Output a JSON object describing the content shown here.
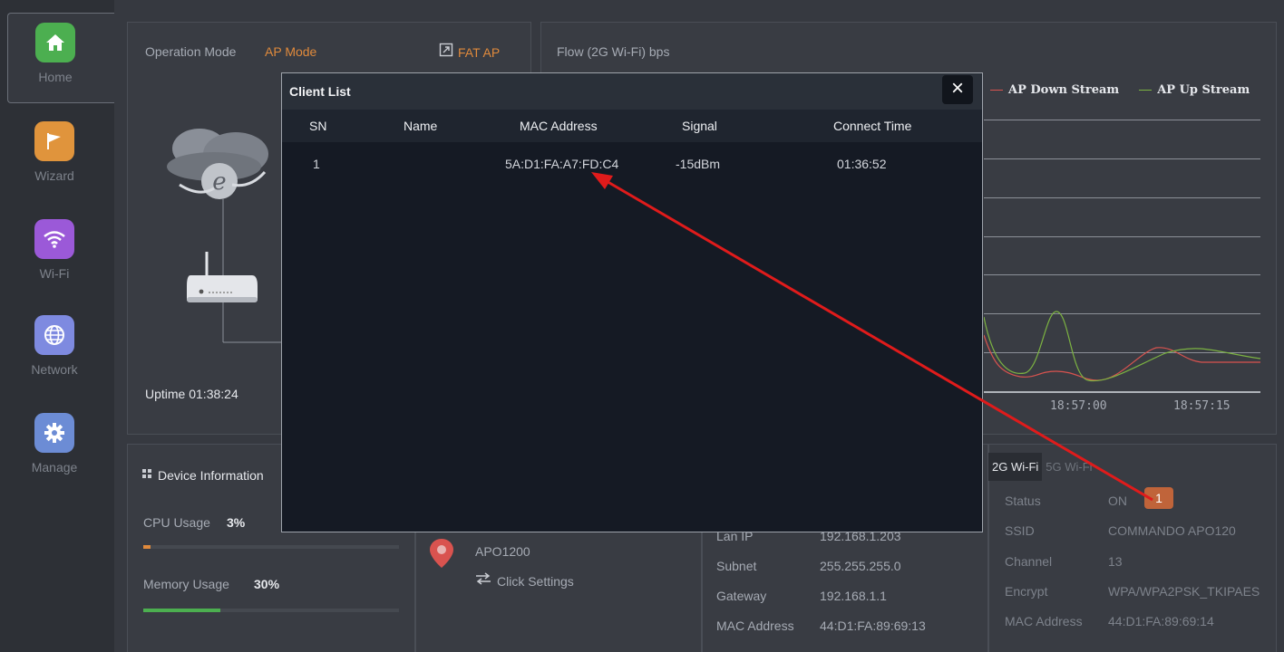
{
  "sidebar": {
    "items": [
      {
        "label": "Home",
        "icon": "home-icon",
        "color": "#4caf50"
      },
      {
        "label": "Wizard",
        "icon": "flag-icon",
        "color": "#e0943c"
      },
      {
        "label": "Wi-Fi",
        "icon": "wifi-icon",
        "color": "#9b59d8"
      },
      {
        "label": "Network",
        "icon": "globe-icon",
        "color": "#7e8ae0"
      },
      {
        "label": "Manage",
        "icon": "gear-icon",
        "color": "#6c8cd5"
      }
    ]
  },
  "status_panel": {
    "operation_mode_label": "Operation Mode",
    "operation_mode_value": "AP Mode",
    "fat_ap_label": "FAT AP",
    "uptime_label": "Uptime 01:38:24"
  },
  "flow_panel": {
    "title": "Flow (2G Wi-Fi) bps",
    "legend_down": "AP Down Stream",
    "legend_up": "AP Up Stream",
    "colors": {
      "down": "#d9534f",
      "up": "#7cb342"
    }
  },
  "chart_data": {
    "type": "line",
    "title": "Flow (2G Wi-Fi) bps",
    "x_tick_labels": [
      "18:57:00",
      "18:57:15"
    ],
    "series": [
      {
        "name": "AP Down Stream",
        "color": "#d9534f"
      },
      {
        "name": "AP Up Stream",
        "color": "#7cb342"
      }
    ],
    "legend": "top-right",
    "grid": true
  },
  "device_info": {
    "title": "Device Information",
    "cpu_label": "CPU Usage",
    "cpu_value": "3%",
    "cpu_fraction": 0.03,
    "memory_label": "Memory Usage",
    "memory_value": "30%",
    "memory_fraction": 0.3
  },
  "location": {
    "name": "APO1200",
    "settings_label": "Click Settings"
  },
  "lan": {
    "lan_ip_label": "Lan IP",
    "lan_ip_value": "192.168.1.203",
    "subnet_label": "Subnet",
    "subnet_value": "255.255.255.0",
    "gateway_label": "Gateway",
    "gateway_value": "192.168.1.1",
    "mac_label": "MAC Address",
    "mac_value": "44:D1:FA:89:69:13"
  },
  "wifi_info": {
    "tab_2g": "2G Wi-Fi",
    "tab_5g": "5G Wi-Fi",
    "status_label": "Status",
    "status_value": "ON",
    "client_count": "1",
    "ssid_label": "SSID",
    "ssid_value": "COMMANDO APO120",
    "channel_label": "Channel",
    "channel_value": "13",
    "encrypt_label": "Encrypt",
    "encrypt_value": "WPA/WPA2PSK_TKIPAES",
    "mac_label": "MAC Address",
    "mac_value": "44:D1:FA:89:69:14"
  },
  "client_list": {
    "title": "Client List",
    "close_label": "×",
    "columns": [
      "SN",
      "Name",
      "MAC Address",
      "Signal",
      "Connect Time"
    ],
    "rows": [
      {
        "sn": "1",
        "name": "",
        "mac": "5A:D1:FA:A7:FD:C4",
        "signal": "-15dBm",
        "connect_time": "01:36:52"
      }
    ]
  },
  "annotation": {
    "arrow_color": "#e01b1b"
  }
}
